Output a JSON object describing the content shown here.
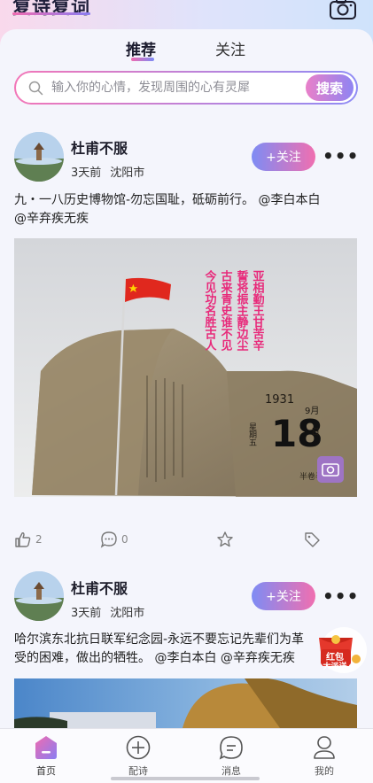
{
  "header": {
    "app_title": "复诗复词",
    "camera_icon": "camera-icon"
  },
  "tabs": [
    {
      "label": "推荐",
      "active": true
    },
    {
      "label": "关注",
      "active": false
    }
  ],
  "search": {
    "placeholder": "输入你的心情，发现周围的心有灵犀",
    "button_label": "搜索"
  },
  "posts": [
    {
      "author": "杜甫不服",
      "time": "3天前",
      "location": "沈阳市",
      "follow_label": "+关注",
      "more_label": "•••",
      "text_line1": "九・一八历史博物馆-勿忘国耻，砥砺前行。 @李白本白",
      "text_line2": "@辛弃疾无疾",
      "image": {
        "poem_columns": [
          "亚相勤王甘苦辛",
          "誓将振主静边尘",
          "古来青史谁不见",
          "今见功名胜古人"
        ],
        "monument_year": "1931",
        "monument_day": "18",
        "monument_month": "9月",
        "monument_weekday": "星期五",
        "monument_small": "日",
        "stamp_text": "半卷半吟"
      },
      "likes": "2",
      "comments": "0"
    },
    {
      "author": "杜甫不服",
      "time": "3天前",
      "location": "沈阳市",
      "follow_label": "+关注",
      "more_label": "•••",
      "text_line1": "哈尔滨东北抗日联军纪念园-永远不要忘记先辈们为革",
      "text_line2": "受的困难，做出的牺牲。 @李白本白 @辛弃疾无疾"
    }
  ],
  "floating_badge": {
    "line1": "红包",
    "line2": "大派送"
  },
  "bottom_nav": [
    {
      "label": "首页",
      "icon": "home-icon",
      "active": true
    },
    {
      "label": "配诗",
      "icon": "plus-circle-icon",
      "active": false
    },
    {
      "label": "消息",
      "icon": "message-icon",
      "active": false
    },
    {
      "label": "我的",
      "icon": "profile-icon",
      "active": false
    }
  ],
  "colors": {
    "accent_pink": "#f06bb0",
    "accent_purple": "#8a7df2",
    "background": "#f4f5fc"
  }
}
